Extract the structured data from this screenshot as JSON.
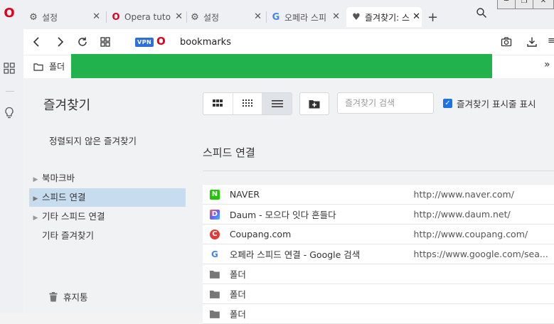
{
  "app": {
    "logo": "O"
  },
  "tabs": [
    {
      "title": "설정",
      "icon": "gear-icon"
    },
    {
      "title": "Opera tuto",
      "icon": "opera-icon"
    },
    {
      "title": "설정",
      "icon": "gear-icon"
    },
    {
      "title": "오페라 스피",
      "icon": "google-icon"
    },
    {
      "title": "즐겨찾기: 스",
      "icon": "heart-icon",
      "active": true
    }
  ],
  "new_tab_label": "+",
  "address": {
    "vpn_label": "VPN",
    "opera_glyph": "O",
    "url": "bookmarks"
  },
  "bookmark_bar": {
    "folder_label": "폴더",
    "more": "»"
  },
  "sidebar": {
    "title": "즐겨찾기",
    "unsorted": "정렬되지 않은 즐겨찾기",
    "items": [
      {
        "label": "북마크바",
        "expandable": true,
        "selected": false
      },
      {
        "label": "스피드 연결",
        "expandable": true,
        "selected": true
      },
      {
        "label": "기타 스피드 연결",
        "expandable": true,
        "selected": false
      },
      {
        "label": "기타 즐겨찾기",
        "expandable": false,
        "selected": false
      }
    ],
    "trash": "휴지통"
  },
  "toolbar": {
    "search_placeholder": "즐겨찾기 검색",
    "show_bar_label": "즐겨찾기 표시줄 표시",
    "show_bar_checked": true
  },
  "section": {
    "title": "스피드 연결"
  },
  "bookmarks": [
    {
      "name": "NAVER",
      "url": "http://www.naver.com/",
      "icon": "naver-icon",
      "badge": "N",
      "color": "#1ec800"
    },
    {
      "name": "Daum - 모으다 잇다 흔들다",
      "url": "http://www.daum.net/",
      "icon": "daum-icon",
      "badge": "D",
      "color": "#e8e8ef"
    },
    {
      "name": "Coupang.com",
      "url": "http://www.coupang.com/",
      "icon": "coupang-icon",
      "badge": "C",
      "color": "#e53935"
    },
    {
      "name": "오페라 스피드 연결 - Google 검색",
      "url": "https://www.google.com/sea...",
      "icon": "google-icon",
      "badge": "G",
      "color": "#ffffff"
    },
    {
      "name": "폴더",
      "url": "",
      "icon": "folder-icon"
    },
    {
      "name": "폴더",
      "url": "",
      "icon": "folder-icon"
    },
    {
      "name": "폴더",
      "url": "",
      "icon": "folder-icon"
    }
  ],
  "colors": {
    "accent": "#1a73e8",
    "selected_row": "#c8dcf0",
    "green_bar": "#21b14d",
    "opera_red": "#e0001b"
  }
}
